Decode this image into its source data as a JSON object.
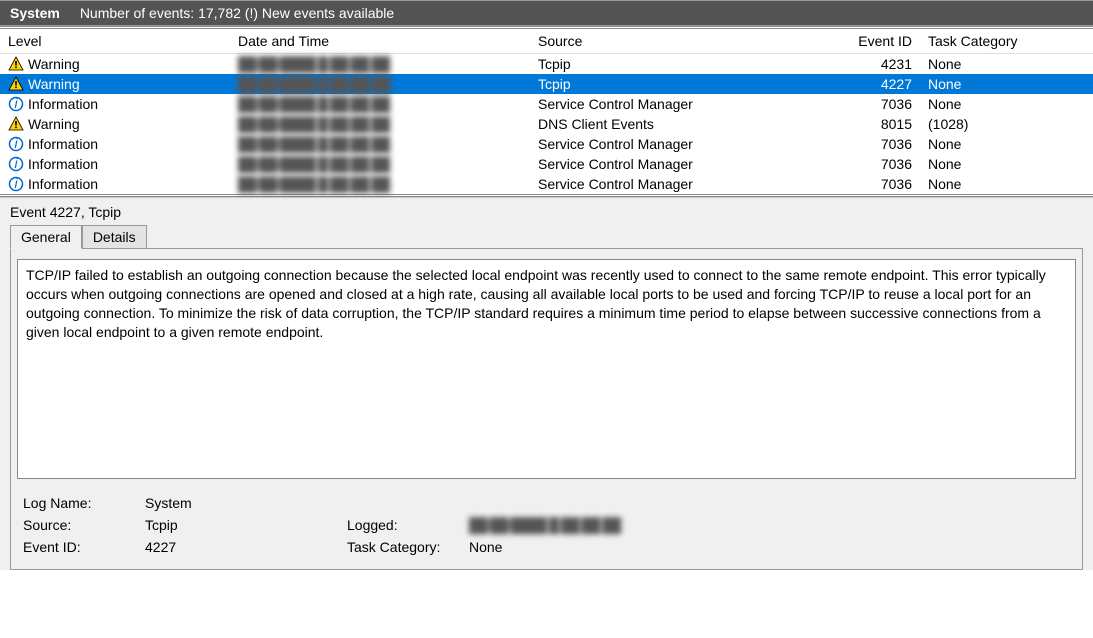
{
  "header": {
    "title": "System",
    "status": "Number of events: 17,782 (!) New events available"
  },
  "columns": {
    "level": "Level",
    "date": "Date and Time",
    "source": "Source",
    "eventid": "Event ID",
    "task": "Task Category"
  },
  "rows": [
    {
      "icon": "warning",
      "level": "Warning",
      "date": "██/██/████ █:██:██ ██",
      "source": "Tcpip",
      "id": "4231",
      "task": "None",
      "selected": false
    },
    {
      "icon": "warning",
      "level": "Warning",
      "date": "██/██/████ █:██:██ ██",
      "source": "Tcpip",
      "id": "4227",
      "task": "None",
      "selected": true
    },
    {
      "icon": "info",
      "level": "Information",
      "date": "██/██/████ █:██:██ ██",
      "source": "Service Control Manager",
      "id": "7036",
      "task": "None",
      "selected": false
    },
    {
      "icon": "warning",
      "level": "Warning",
      "date": "██/██/████ █:██:██ ██",
      "source": "DNS Client Events",
      "id": "8015",
      "task": "(1028)",
      "selected": false
    },
    {
      "icon": "info",
      "level": "Information",
      "date": "██/██/████ █:██:██ ██",
      "source": "Service Control Manager",
      "id": "7036",
      "task": "None",
      "selected": false
    },
    {
      "icon": "info",
      "level": "Information",
      "date": "██/██/████ █:██:██ ██",
      "source": "Service Control Manager",
      "id": "7036",
      "task": "None",
      "selected": false
    },
    {
      "icon": "info",
      "level": "Information",
      "date": "██/██/████ █:██:██ ██",
      "source": "Service Control Manager",
      "id": "7036",
      "task": "None",
      "selected": false
    }
  ],
  "detail": {
    "heading": "Event 4227, Tcpip",
    "tabs": {
      "general": "General",
      "details": "Details"
    },
    "description": "TCP/IP failed to establish an outgoing connection because the selected local endpoint was recently used to connect to the same remote endpoint. This error typically occurs when outgoing connections are opened and closed at a high rate, causing all available local ports to be used and forcing TCP/IP to reuse a local port for an outgoing connection. To minimize the risk of data corruption, the TCP/IP standard requires a minimum time period to elapse between successive connections from a given local endpoint to a given remote endpoint.",
    "fields": {
      "logname_label": "Log Name:",
      "logname": "System",
      "source_label": "Source:",
      "source": "Tcpip",
      "logged_label": "Logged:",
      "logged": "██/██/████ █:██:██ ██",
      "eventid_label": "Event ID:",
      "eventid": "4227",
      "task_label": "Task Category:",
      "task": "None"
    }
  }
}
